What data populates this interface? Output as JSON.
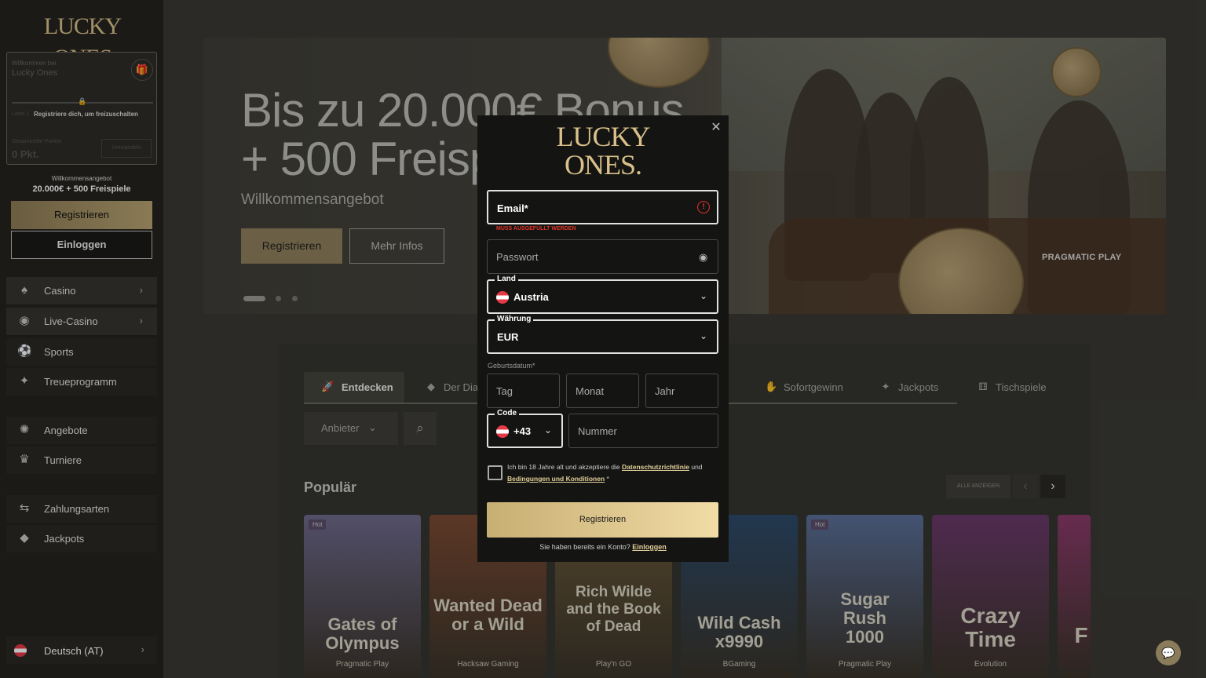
{
  "sidebar": {
    "logo": "LUCKY ONES",
    "welcome_card": {
      "greeting": "Willkommen bei",
      "name": "Lucky Ones",
      "level": "Level 1",
      "register_hint": "Registriere dich, um freizuschalten",
      "points_label": "Gesammelte Punkte",
      "points_value": "0 Pkt.",
      "redeem_label": "Umwandeln"
    },
    "offer_label": "Willkommensangebot",
    "offer_value": "20.000€ + 500 Freispiele",
    "register_label": "Registrieren",
    "login_label": "Einloggen",
    "nav": [
      {
        "label": "Casino",
        "icon": "cards-icon"
      },
      {
        "label": "Live-Casino",
        "icon": "chip-icon"
      },
      {
        "label": "Sports",
        "icon": "ball-icon"
      },
      {
        "label": "Treueprogramm",
        "icon": "sparkle-icon"
      },
      {
        "label": "Angebote",
        "icon": "party-icon"
      },
      {
        "label": "Turniere",
        "icon": "trophy-icon"
      },
      {
        "label": "Zahlungsarten",
        "icon": "exchange-icon"
      },
      {
        "label": "Jackpots",
        "icon": "diamond-icon"
      }
    ],
    "language": "Deutsch (AT)"
  },
  "hero": {
    "headline_1": "Bis zu 20.000€ Bonus",
    "headline_2": "+ 500 Freispiele",
    "subtitle": "Willkommensangebot",
    "register_label": "Registrieren",
    "more_label": "Mehr Infos",
    "provider": "PRAGMATIC PLAY"
  },
  "lobby": {
    "tabs": [
      {
        "label": "Entdecken",
        "icon": "rocket-icon"
      },
      {
        "label": "Der Diamant",
        "icon": "diamond-icon"
      },
      {
        "label": "Sofortgewinn",
        "icon": "handshake-icon"
      },
      {
        "label": "Jackpots",
        "icon": "sparkle-icon"
      },
      {
        "label": "Tischspiele",
        "icon": "dice-icon"
      }
    ],
    "provider_filter": "Anbieter",
    "section_title": "Populär",
    "show_all": "ALLE ANZEIGEN",
    "games": [
      {
        "title": "Gates of Olympus",
        "provider": "Pragmatic Play",
        "badge": "Hot",
        "color": "#6e6a8c"
      },
      {
        "title": "Wanted Dead or a Wild",
        "provider": "Hacksaw Gaming",
        "badge": "",
        "color": "#7a4a33"
      },
      {
        "title": "Rich Wilde and the Book of Dead",
        "provider": "Play'n GO",
        "badge": "",
        "color": "#6a5a3a"
      },
      {
        "title": "Wild Cash x9990",
        "provider": "BGaming",
        "badge": "",
        "color": "#2d4a6a"
      },
      {
        "title": "Sugar Rush 1000",
        "provider": "Pragmatic Play",
        "badge": "Hot",
        "color": "#5a6f98"
      },
      {
        "title": "Crazy Time",
        "provider": "Evolution",
        "badge": "",
        "color": "#6a3a6a"
      },
      {
        "title": "F",
        "provider": "",
        "badge": "",
        "color": "#8a3a6a"
      }
    ]
  },
  "modal": {
    "logo_1": "LUCKY",
    "logo_2": "ONES.",
    "email_label": "Email*",
    "email_error": "MUSS AUSGEFÜLLT WERDEN",
    "password_label": "Passwort",
    "country_label": "Land",
    "country_value": "Austria",
    "currency_label": "Währung",
    "currency_value": "EUR",
    "dob_label": "Geburtsdatum*",
    "day": "Tag",
    "month": "Monat",
    "year": "Jahr",
    "code_label": "Code",
    "code_value": "+43",
    "number_label": "Nummer",
    "agree_pre": "Ich bin 18 Jahre alt und akzeptiere die ",
    "agree_link1": "Datenschutzrichtlinie",
    "agree_mid": " und ",
    "agree_link2": "Bedingungen und Konditionen",
    "agree_post": " *",
    "submit_label": "Registrieren",
    "have_account": "Sie haben bereits ein Konto? ",
    "login_link": "Einloggen"
  }
}
